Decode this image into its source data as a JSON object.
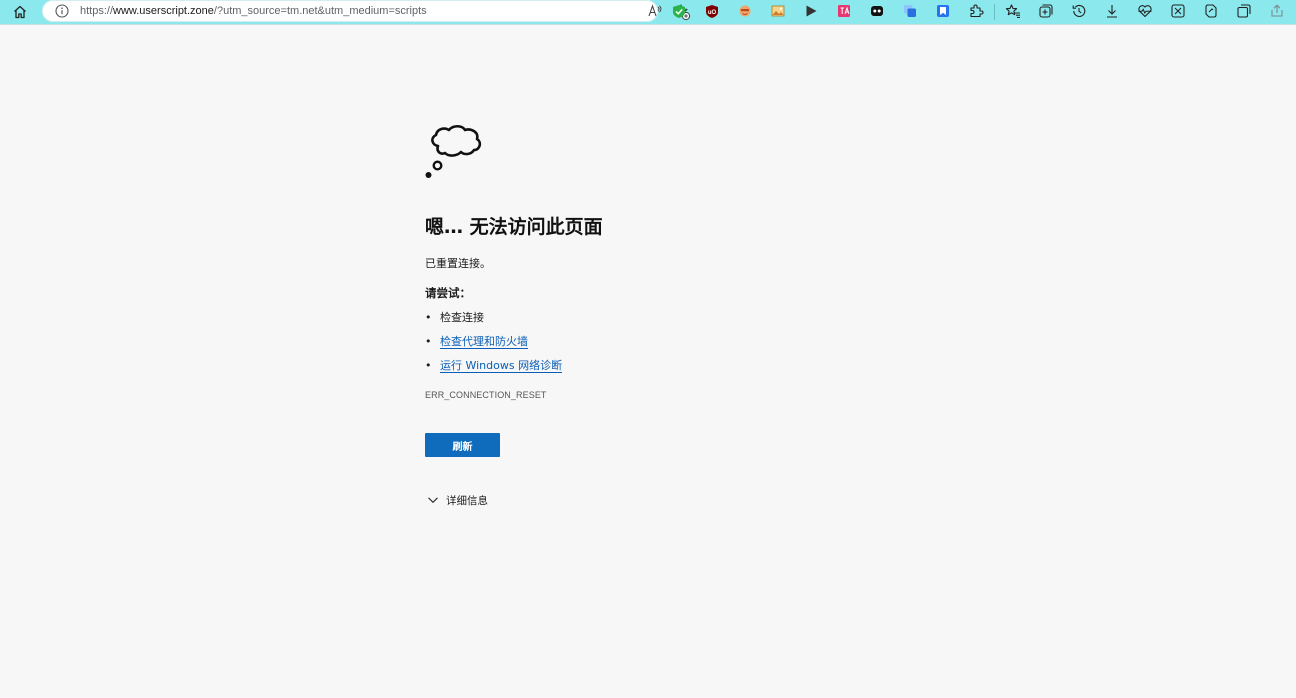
{
  "browser": {
    "url_scheme": "https://",
    "url_host": "www.userscript.zone",
    "url_path": "/?utm_source=tm.net&utm_medium=scripts",
    "icons": {
      "home": "home-icon",
      "site_info": "info-icon",
      "read_aloud": "read-aloud-icon",
      "add_favorite": "add-favorite-icon",
      "favorites": "favorites-icon",
      "collections": "collections-icon",
      "history": "history-icon",
      "downloads": "download-icon",
      "performance": "heartbeat-icon",
      "extensions": "extensions-icon",
      "copilot": "copilot-icon",
      "workspaces": "workspaces-icon",
      "share": "share-icon"
    },
    "extensions": [
      {
        "name": "green-shield-extension-icon",
        "color": "#2bb34a"
      },
      {
        "name": "ublock-extension-icon",
        "color": "#800000",
        "text": "uO"
      },
      {
        "name": "orange-face-extension-icon",
        "color": "#e77a3b"
      },
      {
        "name": "image-extension-icon",
        "color": "#d9a441"
      },
      {
        "name": "play-extension-icon",
        "color": "#333333"
      },
      {
        "name": "pink-translate-extension-icon",
        "color": "#e8366f"
      },
      {
        "name": "black-mask-extension-icon",
        "color": "#111111"
      },
      {
        "name": "blue-copy-extension-icon",
        "color": "#2a6fdb"
      },
      {
        "name": "blue-bookmark-extension-icon",
        "color": "#2874f0"
      }
    ]
  },
  "page": {
    "title": "嗯… 无法访问此页面",
    "message": "已重置连接。",
    "try_label": "请尝试：",
    "suggestions": [
      {
        "text": "检查连接",
        "link": false
      },
      {
        "text": "检查代理和防火墙",
        "link": true
      },
      {
        "text": "运行 Windows 网络诊断",
        "link": true
      }
    ],
    "bullet": "•",
    "error_code": "ERR_CONNECTION_RESET",
    "refresh_label": "刷新",
    "details_label": "详细信息",
    "accent_color": "#0f6cbd",
    "link_color": "#0a5eb8"
  }
}
